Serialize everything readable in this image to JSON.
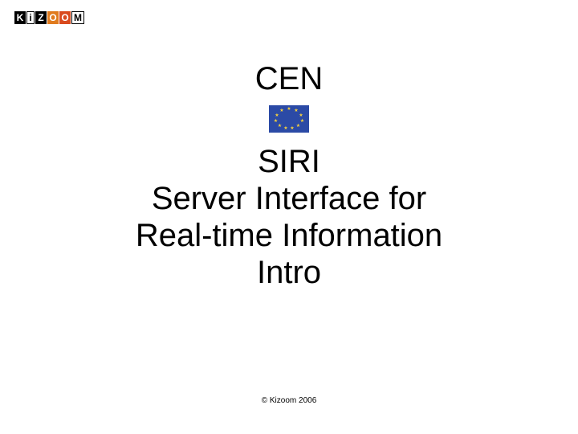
{
  "logo": {
    "letters": [
      "K",
      "i",
      "Z",
      "O",
      "O",
      "M"
    ]
  },
  "slide": {
    "org": "CEN",
    "acronym": "SIRI",
    "title_l1": "Server Interface for",
    "title_l2": "Real-time Information",
    "subtitle": "Intro"
  },
  "flag": {
    "name": "eu-flag"
  },
  "footer": {
    "copyright": "© Kizoom 2006"
  }
}
